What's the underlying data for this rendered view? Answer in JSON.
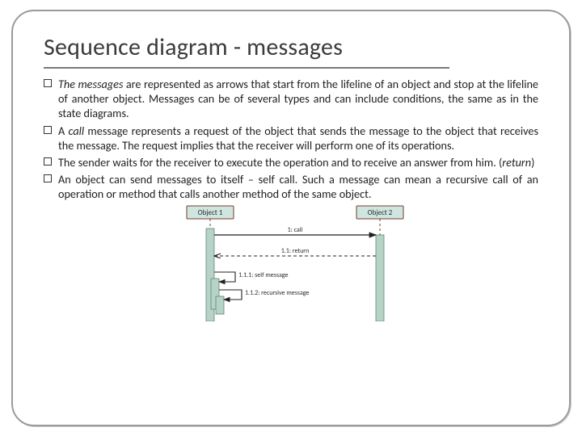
{
  "title": "Sequence diagram - messages",
  "bullets": [
    {
      "prefix_italic": "The messages",
      "rest": " are represented as arrows that start from the lifeline of an object and stop at the lifeline of another object. Messages can be of several types and can include conditions, the same as in the state diagrams."
    },
    {
      "prefix": "A ",
      "mid_italic": "call",
      "rest": " message represents a request of the object that sends the message to the object that receives the message. The request implies that the receiver will perform one of its operations."
    },
    {
      "prefix": "The sender waits for the receiver to execute the operation and to receive an answer from him. (",
      "mid_italic": "return",
      "rest": ")"
    },
    {
      "prefix": "An object can send messages to itself – self call. Such a message can mean a recursive call of an operation or method that calls another method of the same object.",
      "mid_italic": "",
      "rest": ""
    }
  ],
  "diagram": {
    "object1": "Object 1",
    "object2": "Object 2",
    "msg_call": "1: call",
    "msg_return": "1.1: return",
    "msg_self": "1.1.1: self message",
    "msg_recursive": "1.1.2: recursive message",
    "colors": {
      "box_fill": "#cfe6e0",
      "box_stroke": "#7a3a2a",
      "lifeline": "#7a3a2a",
      "activation": "#b7d3c8",
      "activation_stroke": "#5c8876",
      "arrow": "#222222",
      "text": "#2a2a2a"
    }
  }
}
